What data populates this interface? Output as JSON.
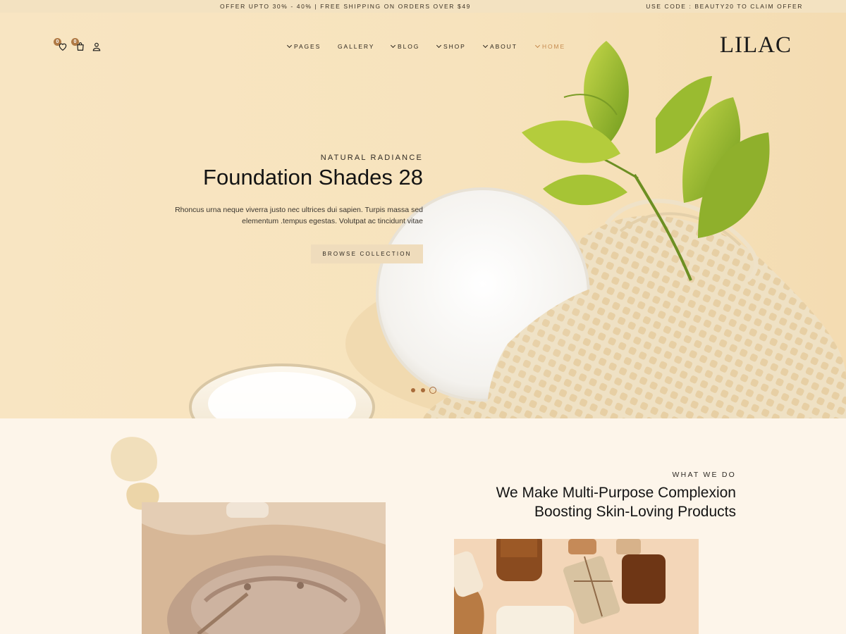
{
  "topbar": {
    "offer_text": "OFFER UPTO 30% - 40% | FREE SHIPPING ON ORDERS OVER $49",
    "code_text": "USE CODE : BEAUTY20 TO CLAIM OFFER"
  },
  "header": {
    "wishlist_count": "0",
    "cart_count": "0",
    "icons": [
      "heart-icon",
      "shopping-bag-icon",
      "user-icon"
    ],
    "nav": [
      {
        "label": "PAGES",
        "has_dropdown": true,
        "active": false
      },
      {
        "label": "GALLERY",
        "has_dropdown": false,
        "active": false
      },
      {
        "label": "BLOG",
        "has_dropdown": true,
        "active": false
      },
      {
        "label": "SHOP",
        "has_dropdown": true,
        "active": false
      },
      {
        "label": "ABOUT",
        "has_dropdown": true,
        "active": false
      },
      {
        "label": "HOME",
        "has_dropdown": true,
        "active": true
      }
    ],
    "logo_text": "LILAC"
  },
  "hero": {
    "eyebrow": "NATURAL RADIANCE",
    "title": "Foundation Shades 28",
    "description": "Rhoncus urna neque viverra justo nec ultrices dui sapien. Turpis massa sed elementum .tempus egestas. Volutpat ac tincidunt vitae",
    "button_label": "BROWSE COLLECTION",
    "slides_total": 3,
    "active_slide": 3
  },
  "section2": {
    "eyebrow": "WHAT WE DO",
    "title": "We Make Multi-Purpose Complexion Boosting Skin-Loving Products"
  },
  "colors": {
    "accent": "#c58a4e",
    "badge": "#b07a45",
    "hero_bg": "#f7e3bd",
    "topbar_bg": "#f3e2c1",
    "page_bg": "#fdf5ea",
    "button_bg": "#efdcbc"
  }
}
